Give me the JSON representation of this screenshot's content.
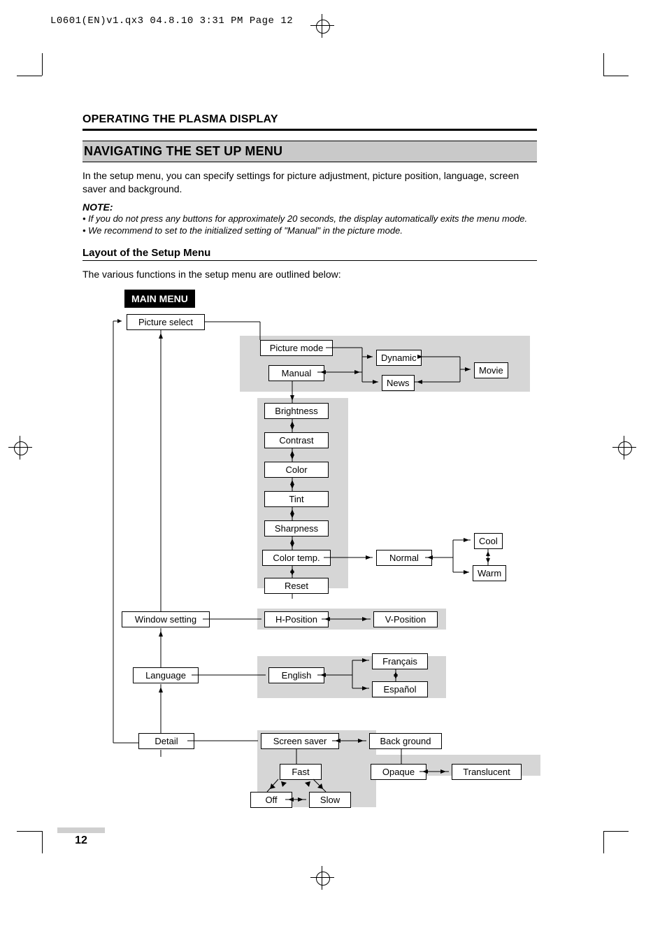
{
  "print_header": "L0601(EN)v1.qx3  04.8.10  3:31 PM  Page 12",
  "page_number": "12",
  "section_title": "OPERATING THE PLASMA DISPLAY",
  "subsection_title": "NAVIGATING THE SET UP MENU",
  "intro_paragraph": "In the setup menu, you can specify settings for picture adjustment, picture position, language, screen saver and background.",
  "note_heading": "NOTE:",
  "note_items": [
    "• If you do not press any buttons for approximately 20 seconds, the display automatically exits the menu mode.",
    "• We recommend to set to the initialized setting of \"Manual\" in the picture mode."
  ],
  "layout_heading": "Layout of the Setup Menu",
  "layout_intro": "The various functions in the setup menu are outlined below:",
  "main_menu_label": "MAIN MENU",
  "nodes": {
    "picture_select": "Picture select",
    "picture_mode": "Picture mode",
    "manual": "Manual",
    "dynamic": "Dynamic",
    "news": "News",
    "movie": "Movie",
    "brightness": "Brightness",
    "contrast": "Contrast",
    "color": "Color",
    "tint": "Tint",
    "sharpness": "Sharpness",
    "color_temp": "Color temp.",
    "normal": "Normal",
    "cool": "Cool",
    "warm": "Warm",
    "reset": "Reset",
    "window_setting": "Window setting",
    "h_position": "H-Position",
    "v_position": "V-Position",
    "language": "Language",
    "english": "English",
    "francais": "Français",
    "espanol": "Español",
    "detail": "Detail",
    "screen_saver": "Screen saver",
    "back_ground": "Back ground",
    "fast": "Fast",
    "off": "Off",
    "slow": "Slow",
    "opaque": "Opaque",
    "translucent": "Translucent"
  }
}
